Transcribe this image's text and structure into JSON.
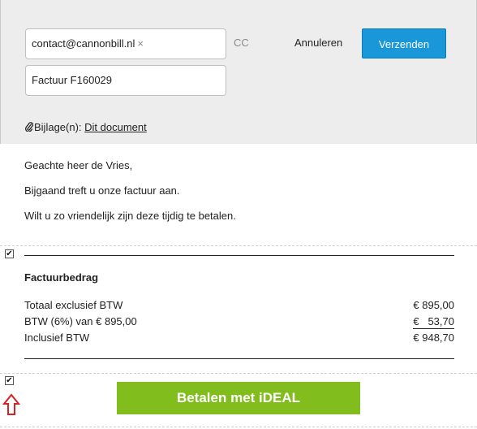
{
  "header": {
    "to_value": "contact@cannonbill.nl",
    "remove_glyph": "×",
    "cc_label": "CC",
    "cancel_label": "Annuleren",
    "send_label": "Verzenden",
    "subject_value": "Factuur F160029",
    "attachments_label": "Bijlage(n):",
    "attachment_link": "Dit document"
  },
  "body": {
    "greeting": "Geachte heer de Vries,",
    "line1": "Bijgaand treft u onze factuur aan.",
    "line2": "Wilt u zo vriendelijk zijn deze tijdig te betalen."
  },
  "invoice": {
    "title": "Factuurbedrag",
    "rows": [
      {
        "label": "Totaal exclusief BTW",
        "value": "€ 895,00"
      },
      {
        "label": "BTW (6%) van € 895,00",
        "value": "€   53,70"
      },
      {
        "label": "Inclusief BTW",
        "value": "€ 948,70"
      }
    ]
  },
  "payment": {
    "button_label": "Betalen met iDEAL"
  },
  "checkboxes": {
    "invoice_block_checked": true,
    "payment_block_checked": true,
    "check_glyph": "✔"
  },
  "colors": {
    "send_button": "#1a97d9",
    "ideal_button": "#80bd1d",
    "arrow": "#d62222"
  },
  "icons": {
    "attachment": "paperclip-icon",
    "pointer": "arrow-up-icon"
  }
}
